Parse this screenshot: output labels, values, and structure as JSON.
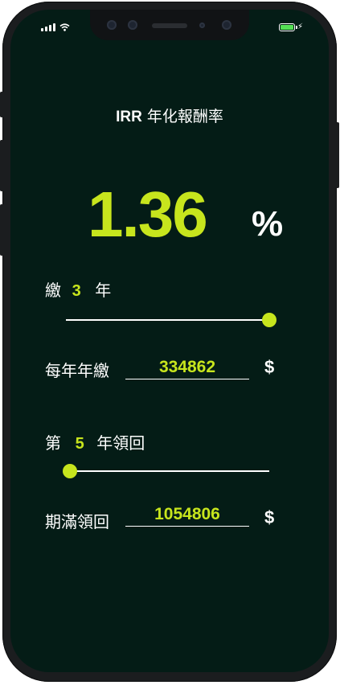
{
  "status": {
    "signal": "signal-icon",
    "wifi": "wifi-icon",
    "battery": "battery-icon",
    "charging": "⚡"
  },
  "header": {
    "title_prefix": "IRR",
    "title_suffix": "年化報酬率"
  },
  "result": {
    "value": "1.36",
    "unit": "%"
  },
  "pay_years": {
    "label_pre": "繳",
    "value": "3",
    "label_post": "年",
    "slider_position": 1.0
  },
  "annual_payment": {
    "label": "每年年繳",
    "value": "334862",
    "currency": "$"
  },
  "receive_year": {
    "label_pre": "第",
    "value": "5",
    "label_post": "年領回",
    "slider_position": 0.0
  },
  "maturity": {
    "label": "期滿領回",
    "value": "1054806",
    "currency": "$"
  },
  "colors": {
    "accent": "#c7e51d",
    "background": "#041c16",
    "text": "#ffffff"
  }
}
